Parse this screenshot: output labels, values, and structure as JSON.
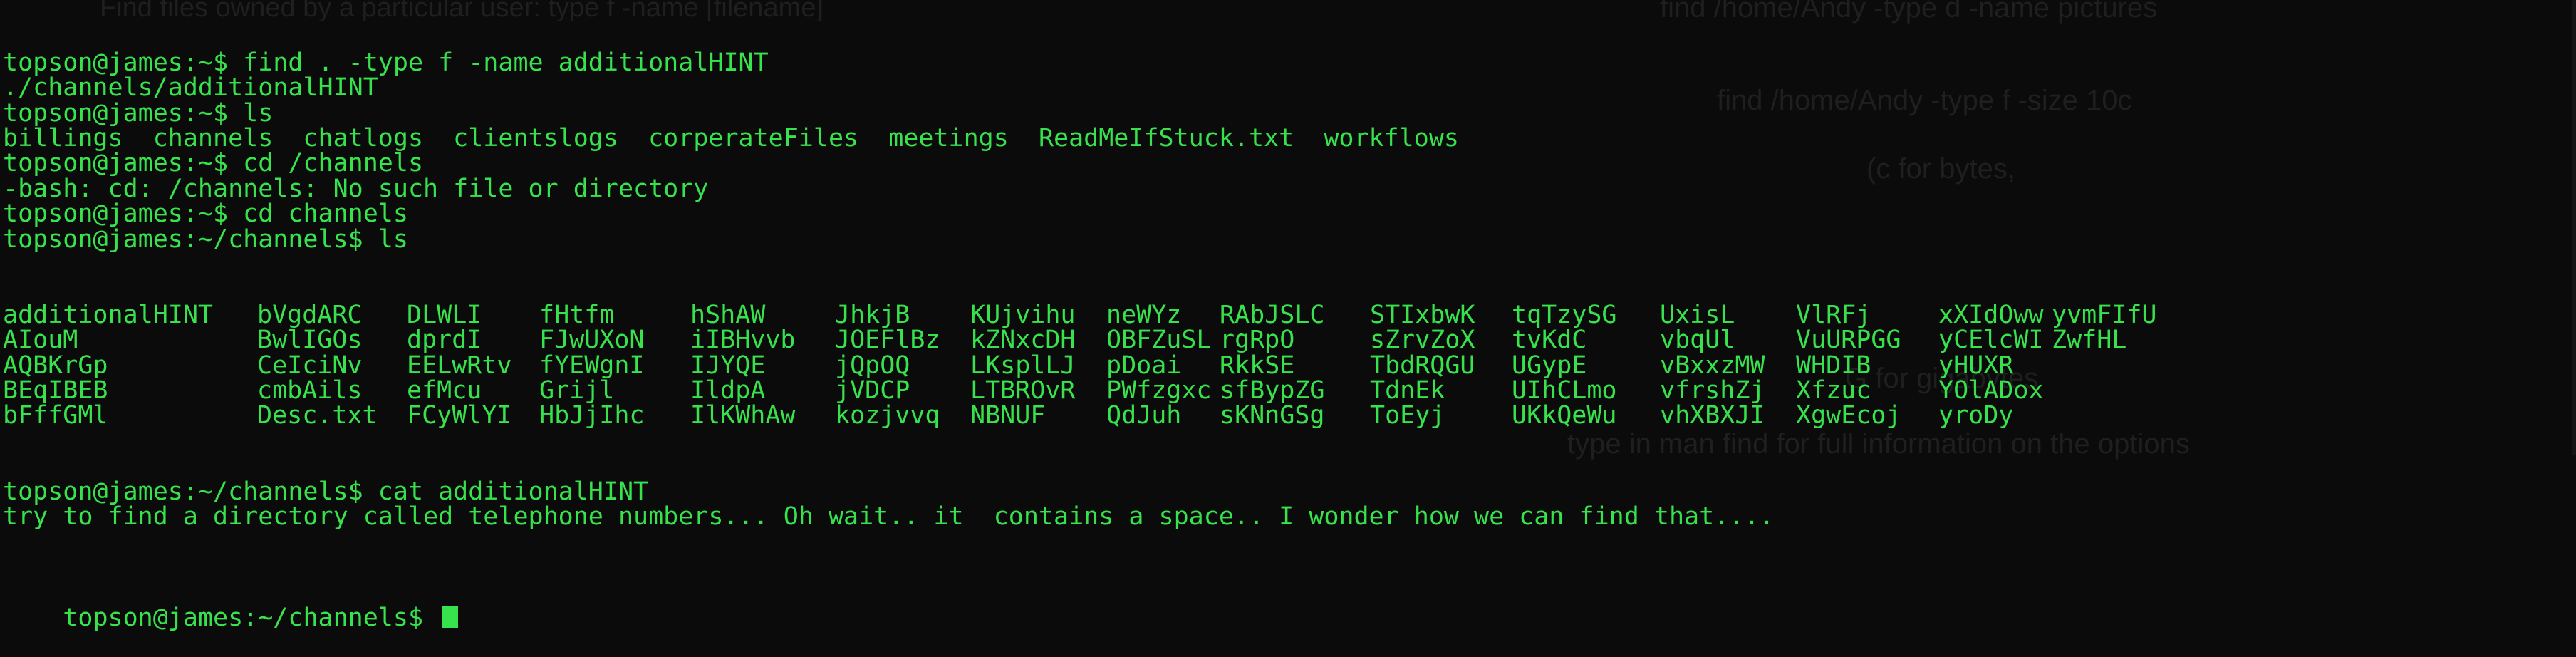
{
  "terminal": {
    "lines": [
      {
        "kind": "cmd",
        "prompt": "topson@james:~$ ",
        "command": "find . -type f -name additionalHINT"
      },
      {
        "kind": "out",
        "text": "./channels/additionalHINT"
      },
      {
        "kind": "cmd",
        "prompt": "topson@james:~$ ",
        "command": "ls"
      },
      {
        "kind": "out",
        "text": "billings  channels  chatlogs  clientslogs  corperateFiles  meetings  ReadMeIfStuck.txt  workflows"
      },
      {
        "kind": "cmd",
        "prompt": "topson@james:~$ ",
        "command": "cd /channels"
      },
      {
        "kind": "out",
        "text": "-bash: cd: /channels: No such file or directory"
      },
      {
        "kind": "cmd",
        "prompt": "topson@james:~$ ",
        "command": "cd channels"
      },
      {
        "kind": "cmd",
        "prompt": "topson@james:~/channels$ ",
        "command": "ls"
      }
    ],
    "ls_columns": [
      [
        "additionalHINT",
        "AIouM",
        "AQBKrGp",
        "BEqIBEB",
        "bFffGMl"
      ],
      [
        "bVgdARC",
        "BwlIGOs",
        "CeIciNv",
        "cmbAils",
        "Desc.txt"
      ],
      [
        "DLWLI",
        "dprdI",
        "EELwRtv",
        "efMcu",
        "FCyWlYI"
      ],
      [
        "fHtfm",
        "FJwUXoN",
        "fYEWgnI",
        "Grijl",
        "HbJjIhc"
      ],
      [
        "hShAW",
        "iIBHvvb",
        "IJYQE",
        "IldpA",
        "IlKWhAw"
      ],
      [
        "JhkjB",
        "JOEFlBz",
        "jQpOQ",
        "jVDCP",
        "kozjvvq"
      ],
      [
        "KUjvihu",
        "kZNxcDH",
        "LKsplLJ",
        "LTBROvR",
        "NBNUF"
      ],
      [
        "neWYz",
        "OBFZuSL",
        "pDoai",
        "PWfzgxc",
        "QdJuh"
      ],
      [
        "RAbJSLC",
        "rgRpO",
        "RkkSE",
        "sfBypZG",
        "sKNnGSg"
      ],
      [
        "STIxbwK",
        "sZrvZoX",
        "TbdRQGU",
        "TdnEk",
        "ToEyj"
      ],
      [
        "tqTzySG",
        "tvKdC",
        "UGypE",
        "UIhCLmo",
        "UKkQeWu"
      ],
      [
        "UxisL",
        "vbqUl",
        "vBxxzMW",
        "vfrshZj",
        "vhXBXJI"
      ],
      [
        "VlRFj",
        "VuURPGG",
        "WHDIB",
        "Xfzuc",
        "XgwEcoj"
      ],
      [
        "xXIdOww",
        "yCElcWI",
        "yHUXR",
        "YOlADox",
        "yroDy"
      ],
      [
        "yvmFIfU",
        "ZwfHL",
        "",
        "",
        ""
      ]
    ],
    "after": [
      {
        "kind": "cmd",
        "prompt": "topson@james:~/channels$ ",
        "command": "cat additionalHINT"
      },
      {
        "kind": "out",
        "text": "try to find a directory called telephone numbers... Oh wait.. it  contains a space.. I wonder how we can find that...."
      }
    ],
    "final_prompt": "topson@james:~/channels$ "
  },
  "background_notes": [
    "find /home/Andy -type d -name pictures",
    "find /home/Andy -type f -size 10c",
    "(c for bytes,",
    "G for gigabytes",
    "Find files owned by a particular user: type f -name [filename]",
    "type in man find for full information on the options"
  ],
  "colors": {
    "terminal_text": "#37e24d",
    "background": "#0b0b0b",
    "cursor": "#38e24d"
  }
}
